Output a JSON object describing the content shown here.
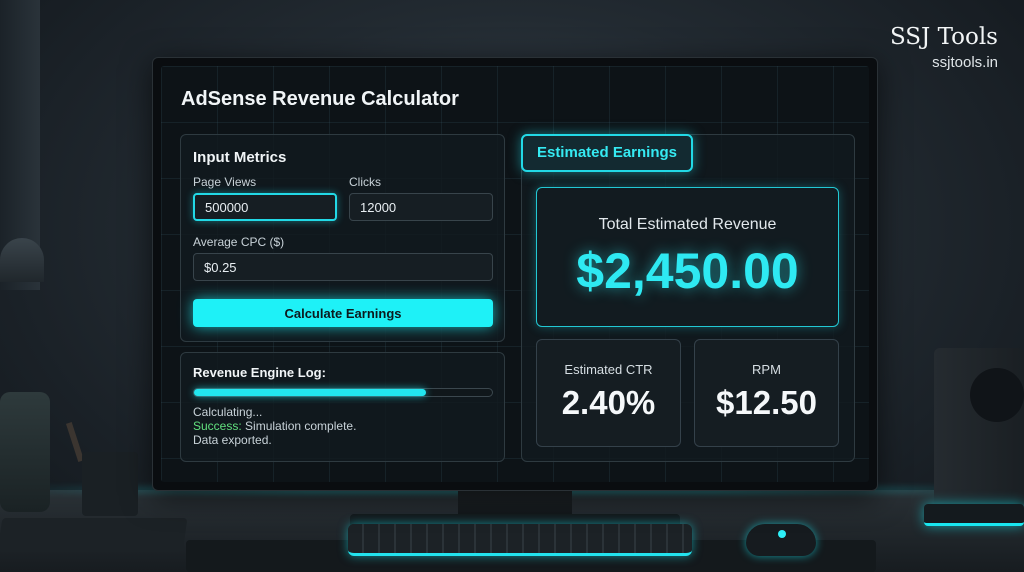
{
  "brand": {
    "name": "SSJ Tools",
    "url": "ssjtools.in"
  },
  "app": {
    "title": "AdSense Revenue Calculator"
  },
  "input_metrics": {
    "heading": "Input Metrics",
    "page_views": {
      "label": "Page Views",
      "value": "500000"
    },
    "clicks": {
      "label": "Clicks",
      "value": "12000"
    },
    "avg_cpc": {
      "label": "Average CPC ($)",
      "value": "$0.25"
    },
    "calculate_label": "Calculate Earnings"
  },
  "log": {
    "heading": "Revenue Engine Log:",
    "progress_fraction": 0.78,
    "line1": "Calculating...",
    "line2_status": "Success:",
    "line2_text": " Simulation complete.",
    "line3": "Data exported."
  },
  "results": {
    "tab_label": "Estimated Earnings",
    "total_label": "Total Estimated Revenue",
    "total_value": "$2,450.00",
    "ctr_label": "Estimated CTR",
    "ctr_value": "2.40%",
    "rpm_label": "RPM",
    "rpm_value": "$12.50"
  },
  "colors": {
    "accent": "#1ef1f7",
    "success": "#62e07e",
    "background": "#0d1317"
  }
}
